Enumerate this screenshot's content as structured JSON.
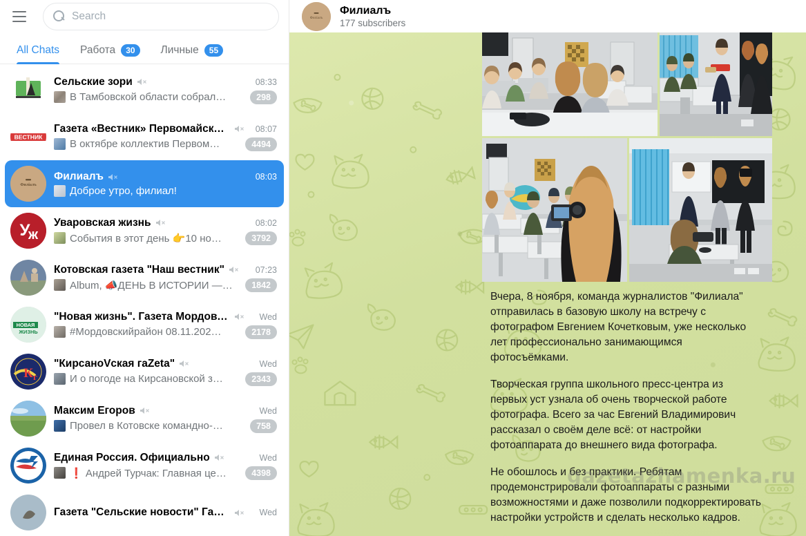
{
  "sidebar": {
    "menu_icon": "hamburger-icon",
    "search": {
      "placeholder": "Search",
      "icon": "search-icon"
    },
    "tabs": [
      {
        "label": "All Chats",
        "badge": "",
        "active": true
      },
      {
        "label": "Работа",
        "badge": "30",
        "active": false
      },
      {
        "label": "Личные",
        "badge": "55",
        "active": false
      }
    ],
    "chats": [
      {
        "title": "Сельские зори",
        "message": "В Тамбовской области собрал…",
        "time": "08:33",
        "count": "298",
        "muted": true,
        "selected": false
      },
      {
        "title": "Газета «Вестник» Первомайског…",
        "message": "В октябре коллектив Первом…",
        "time": "08:07",
        "count": "4494",
        "muted": true,
        "selected": false
      },
      {
        "title": "Филиалъ",
        "message": "Доброе утро, филиал!",
        "time": "08:03",
        "count": "",
        "muted": true,
        "selected": true
      },
      {
        "title": "Уваровская жизнь",
        "message": "События в этот день 👉10 но…",
        "time": "08:02",
        "count": "3792",
        "muted": true,
        "selected": false
      },
      {
        "title": "Котовская газета \"Наш вестник\"",
        "message": "Album, 📣ДЕНЬ В ИСТОРИИ —…",
        "time": "07:23",
        "count": "1842",
        "muted": true,
        "selected": false
      },
      {
        "title": "\"Новая жизнь\". Газета Мордовск…",
        "message": "#Мордовскийрайон 08.11.202…",
        "time": "Wed",
        "count": "2178",
        "muted": true,
        "selected": false
      },
      {
        "title": "\"КирсаноVская гаZeta\"",
        "message": "И о погоде на Кирсановской з…",
        "time": "Wed",
        "count": "2343",
        "muted": true,
        "selected": false
      },
      {
        "title": "Максим Егоров",
        "message": "Провел в Котовске командно-…",
        "time": "Wed",
        "count": "758",
        "muted": true,
        "selected": false
      },
      {
        "title": "Единая Россия. Официально",
        "message": "❗ Андрей Турчак: Главная це…",
        "time": "Wed",
        "count": "4398",
        "muted": true,
        "selected": false
      },
      {
        "title": "Газета \"Сельские новости\" Гаври…",
        "message": "",
        "time": "Wed",
        "count": "",
        "muted": true,
        "selected": false
      }
    ]
  },
  "chat": {
    "header": {
      "title": "Филиалъ",
      "subtitle": "177 subscribers",
      "avatar_text": "Филиалъ"
    },
    "album": {
      "photos": [
        {
          "alt": "two-girls-classroom-photo"
        },
        {
          "alt": "man-presenting-to-students-photo"
        },
        {
          "alt": "girl-filming-classroom-photo"
        },
        {
          "alt": "photographer-demonstration-classroom-photo"
        }
      ]
    },
    "message_paragraphs": [
      "Вчера, 8 ноября, команда журналистов \"Филиала\" отправилась в базовую школу на встречу с фотографом Евгением Кочетковым, уже несколько лет профессионально занимающимся фотосъёмками.",
      "Творческая группа школьного пресс-центра из первых уст узнала об очень творческой работе фотографа. Всего за час Евгений Владимирович рассказал о своём деле всё: от настройки фотоаппарата до внешнего вида фотографа.",
      "Не обошлось и без практики. Ребятам продемонстрировали фотоаппараты с разными возможностями и даже позволили подкорректировать настройки устройств и сделать несколько кадров."
    ],
    "watermark": "gazetazhamenka.ru"
  },
  "colors": {
    "accent": "#3390ec",
    "selected_row": "#3390ec",
    "badge_grey": "#c4c9cc",
    "wallpaper": "#d2e09f",
    "text_secondary": "#707579"
  }
}
